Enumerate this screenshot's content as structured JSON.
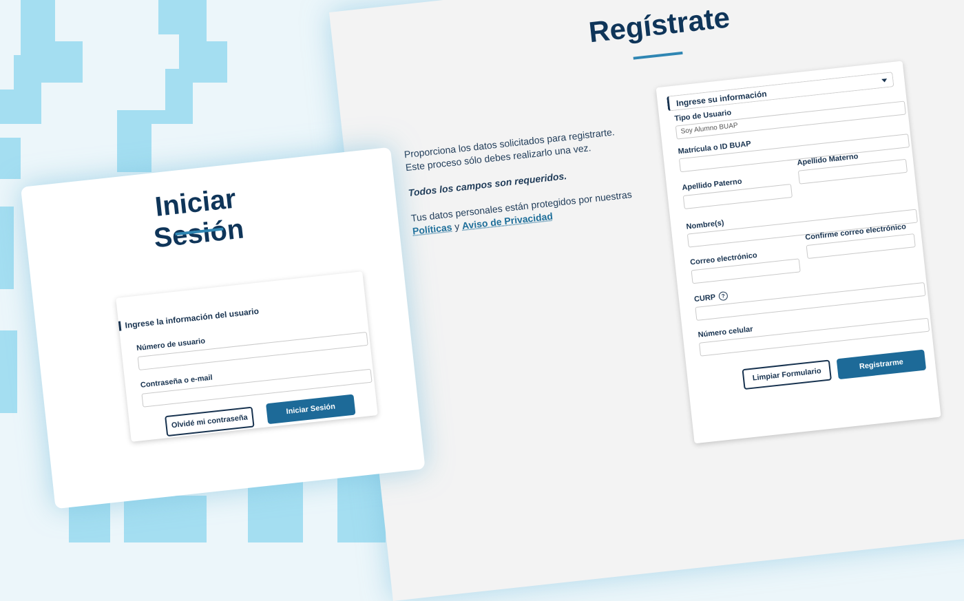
{
  "register": {
    "title": "Regístrate",
    "description": "Proporciona los datos solicitados para registrarte. Este proceso sólo debes realizarlo una vez.",
    "required_note": "Todos los campos son requeridos.",
    "privacy_text_before": "Tus datos personales están protegidos por nuestras",
    "privacy_link_1": "Políticas",
    "privacy_connector": "y",
    "privacy_link_2": "Aviso de Privacidad",
    "section_title": "Ingrese su información",
    "fields": {
      "user_type_label": "Tipo de Usuario",
      "user_type_value": "Soy Alumno BUAP",
      "matricula_label": "Matrícula o ID BUAP",
      "apellido_paterno_label": "Apellido Paterno",
      "apellido_materno_label": "Apellido Materno",
      "nombres_label": "Nombre(s)",
      "correo_label": "Correo electrónico",
      "confirm_correo_label": "Confirme correo electrónico",
      "curp_label": "CURP",
      "celular_label": "Número celular"
    },
    "clear_button": "Limpiar Formulario",
    "submit_button": "Registrarme"
  },
  "login": {
    "title": "Iniciar Sesión",
    "section_title": "Ingrese la información del usuario",
    "username_label": "Número de usuario",
    "password_label": "Contraseña o e-mail",
    "forgot_button": "Olvidé mi contraseña",
    "submit_button": "Iniciar Sesión"
  },
  "icons": {
    "help": "?"
  },
  "colors": {
    "primary_dark": "#0f3559",
    "accent": "#2f86b3",
    "button_blue": "#1d6a98",
    "pattern": "#9fdcf0"
  }
}
